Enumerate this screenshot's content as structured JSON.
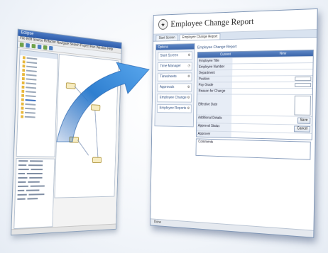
{
  "front": {
    "title": "Employee Change Report",
    "tabs": [
      "Start Screen",
      "Employee Change Report"
    ],
    "sidebar_header": "Options",
    "sidebar_items": [
      {
        "label": "Start Screen",
        "icon": "gear-icon"
      },
      {
        "label": "Time Manager",
        "icon": "clock-icon"
      },
      {
        "label": "Timesheets",
        "icon": "gear-icon"
      },
      {
        "label": "Approvals",
        "icon": "gear-icon"
      },
      {
        "label": "Employee Change",
        "icon": "gear-icon"
      },
      {
        "label": "Employee Reports",
        "icon": "gear-icon"
      }
    ],
    "section_title": "Employee Change Report",
    "grid": {
      "columns": [
        "Current",
        "New"
      ],
      "rows": [
        {
          "label": "Employee Title",
          "value": ""
        },
        {
          "label": "Employee Number",
          "value": ""
        },
        {
          "label": "Department",
          "value": ""
        },
        {
          "label": "Position",
          "value": ""
        },
        {
          "label": "Pay Grade",
          "value": ""
        },
        {
          "label": "Reason for Change",
          "value": ""
        },
        {
          "label": "Effective Date",
          "value": ""
        },
        {
          "label": "Additional Details",
          "value": ""
        },
        {
          "label": "Approval Status",
          "value": ""
        },
        {
          "label": "Approver",
          "value": ""
        }
      ],
      "buttons": [
        "Save",
        "Cancel"
      ]
    },
    "comments_label": "Comments",
    "footer": "Done"
  },
  "back": {
    "title": "Eclipse",
    "menu": "File Edit Source Refactor Navigate Search Project Run Window Help"
  },
  "colors": {
    "arrow": "#2f7fd0",
    "header_blue": "#3c66aa",
    "node": "#f7ecc0"
  }
}
